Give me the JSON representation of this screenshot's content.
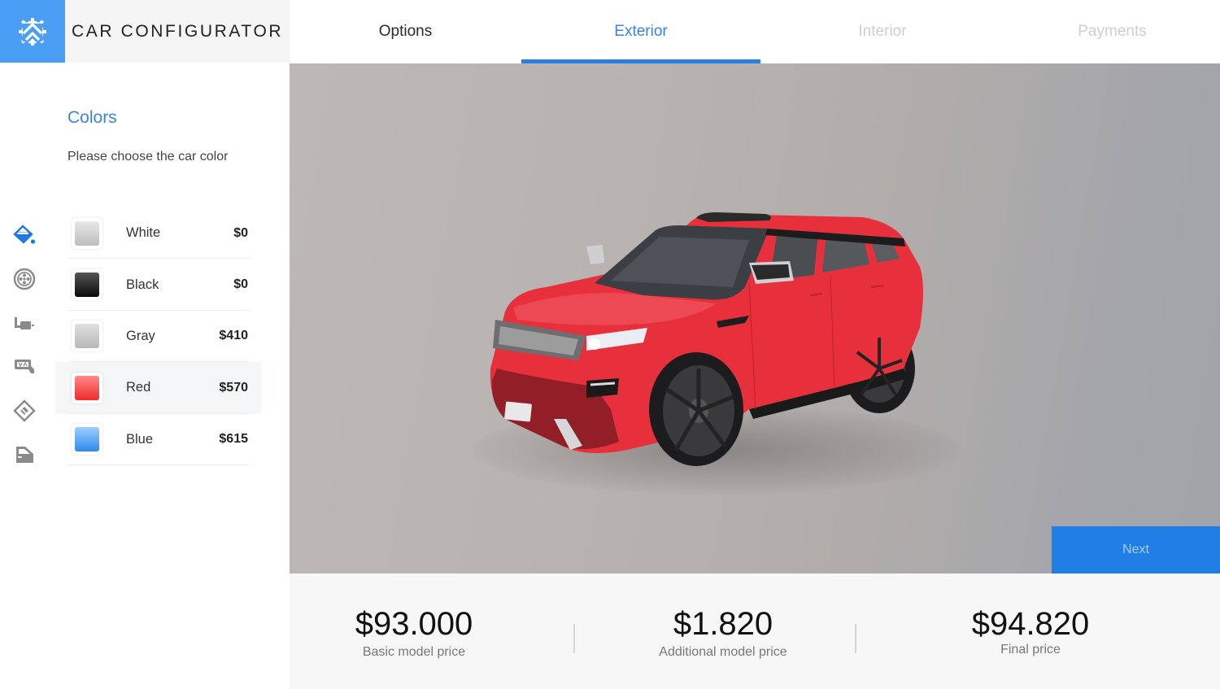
{
  "app": {
    "title": "CAR CONFIGURATOR",
    "logo_icon": "gear-house-logo-icon",
    "accent_color": "#2a7fe2"
  },
  "tabs": [
    {
      "label": "Options",
      "state": "completed"
    },
    {
      "label": "Exterior",
      "state": "active"
    },
    {
      "label": "Interior",
      "state": "disabled"
    },
    {
      "label": "Payments",
      "state": "disabled"
    }
  ],
  "rail_icons": [
    {
      "name": "paint-bucket-icon",
      "active": true
    },
    {
      "name": "wheel-icon",
      "active": false
    },
    {
      "name": "exhaust-icon",
      "active": false
    },
    {
      "name": "mirror-icon",
      "active": false
    },
    {
      "name": "tag-icon",
      "active": false
    },
    {
      "name": "car-door-icon",
      "active": false
    }
  ],
  "colors_section": {
    "title": "Colors",
    "subtitle": "Please choose the car color",
    "selected": "Red",
    "items": [
      {
        "name": "White",
        "price": "$0",
        "swatch": [
          "#e8e8e8",
          "#bdbdbd"
        ]
      },
      {
        "name": "Black",
        "price": "$0",
        "swatch": [
          "#555555",
          "#0a0a0a"
        ]
      },
      {
        "name": "Gray",
        "price": "$410",
        "swatch": [
          "#e0e0e0",
          "#b8b8b8"
        ]
      },
      {
        "name": "Red",
        "price": "$570",
        "swatch": [
          "#ff8a8a",
          "#ef2a2a"
        ]
      },
      {
        "name": "Blue",
        "price": "$615",
        "swatch": [
          "#9ccfff",
          "#2d8ae8"
        ]
      }
    ]
  },
  "viewer": {
    "car_color": "#e8303c",
    "next_label": "Next"
  },
  "prices": {
    "basic": {
      "value": "$93.000",
      "label": "Basic model price"
    },
    "additional": {
      "value": "$1.820",
      "label": "Additional model price"
    },
    "final": {
      "value": "$94.820",
      "label": "Final price"
    }
  }
}
